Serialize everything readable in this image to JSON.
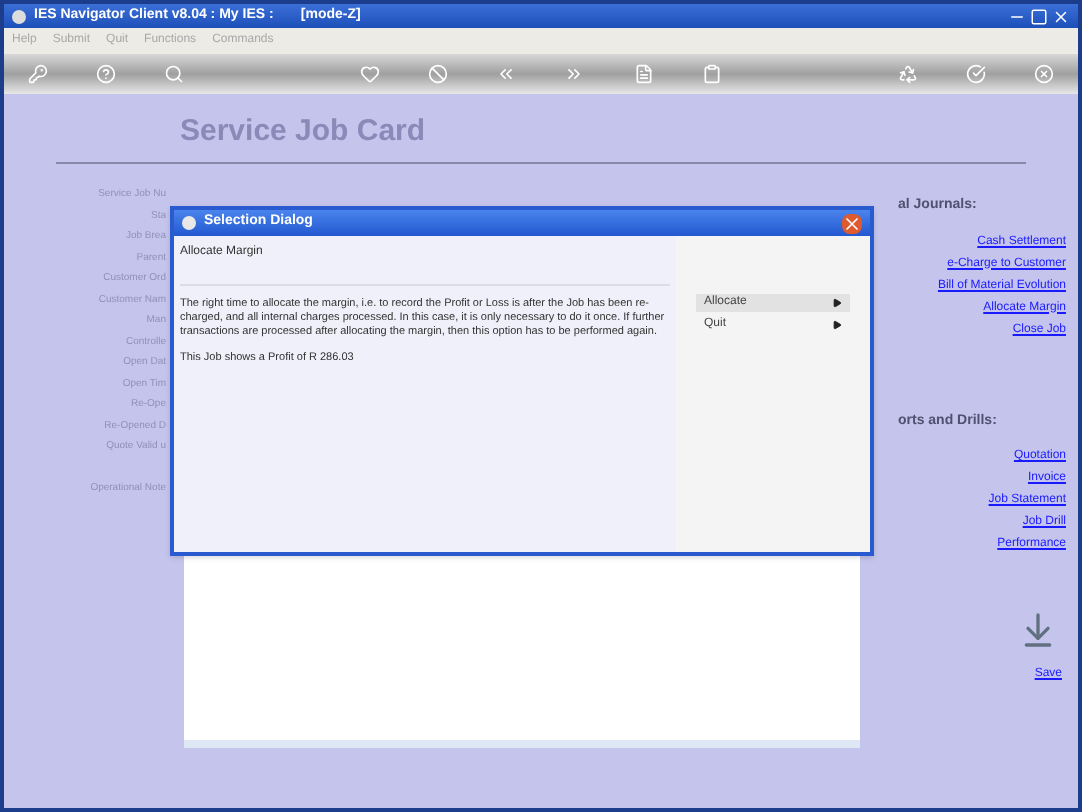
{
  "window": {
    "title": "IES Navigator Client v8.04 : My IES :       [mode-Z]"
  },
  "menu": [
    "Help",
    "Submit",
    "Quit",
    "Functions",
    "Commands"
  ],
  "page": {
    "title": "Service Job Card",
    "field_labels": [
      "Service Job Nu",
      "Sta",
      "Job Brea",
      "Parent",
      "Customer Ord",
      "Customer Nam",
      "Man",
      "Controlle",
      "Open Dat",
      "Open Tim",
      "Re-Ope",
      "Re-Opened D",
      "Quote Valid u",
      "Operational Note"
    ],
    "journals": {
      "heading": "al Journals:",
      "links": [
        "Cash Settlement",
        "e-Charge to Customer",
        "Bill of Material Evolution",
        "Allocate Margin",
        "Close Job"
      ]
    },
    "reports": {
      "heading": "orts and Drills:",
      "links": [
        "Quotation",
        "Invoice",
        "Job Statement",
        "Job Drill",
        "Performance"
      ]
    },
    "save": "Save"
  },
  "dialog": {
    "title": "Selection Dialog",
    "heading": "Allocate Margin",
    "message": "The right time to allocate the margin, i.e. to record the Profit or Loss is after the Job has been re-charged, and all internal charges processed. In this case, it is only necessary to do it once. If further transactions are processed after allocating the margin, then this option has to be performed again.",
    "note": "This Job shows a Profit of R 286.03",
    "options": [
      {
        "label": "Allocate",
        "selected": true
      },
      {
        "label": "Quit",
        "selected": false
      }
    ]
  }
}
